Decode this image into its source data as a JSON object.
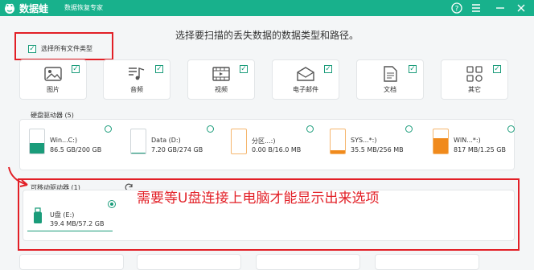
{
  "app": {
    "name": "数据蛙",
    "subtitle": "数据恢复专家"
  },
  "heading": "选择要扫描的丢失数据的数据类型和路径。",
  "select_all": {
    "label": "选择所有文件类型",
    "checked": true
  },
  "file_types": [
    {
      "label": "图片",
      "icon": "image-icon"
    },
    {
      "label": "音频",
      "icon": "audio-icon"
    },
    {
      "label": "视频",
      "icon": "video-icon"
    },
    {
      "label": "电子邮件",
      "icon": "email-icon"
    },
    {
      "label": "文档",
      "icon": "document-icon"
    },
    {
      "label": "其它",
      "icon": "other-icon"
    }
  ],
  "hard_drives": {
    "title": "硬盘驱动器 (5)",
    "items": [
      {
        "name": "Win...C:)",
        "size": "86.5 GB/200 GB",
        "used": 0.43,
        "color": "#1a9c7a"
      },
      {
        "name": "Data (D:)",
        "size": "7.20 GB/274 GB",
        "used": 0.03,
        "color": "#1a9c7a"
      },
      {
        "name": "分区...:)",
        "size": "0.00 B/16.0 MB",
        "used": 0.0,
        "color": "#f08a1c"
      },
      {
        "name": "SYS...*:)",
        "size": "35.5 MB/256 MB",
        "used": 0.14,
        "color": "#f08a1c"
      },
      {
        "name": "WIN...*:)",
        "size": "817 MB/1.25 GB",
        "used": 0.65,
        "color": "#f08a1c"
      }
    ]
  },
  "removable": {
    "title": "可移动驱动器 (1)",
    "items": [
      {
        "name": "U盘 (E:)",
        "size": "39.4 MB/57.2 GB",
        "selected": true
      }
    ]
  },
  "annotation": "需要等U盘连接上电脑才能显示出来选项",
  "colors": {
    "brand": "#18b18c",
    "accent": "#1a9c7a",
    "annotation": "#e21f26"
  }
}
